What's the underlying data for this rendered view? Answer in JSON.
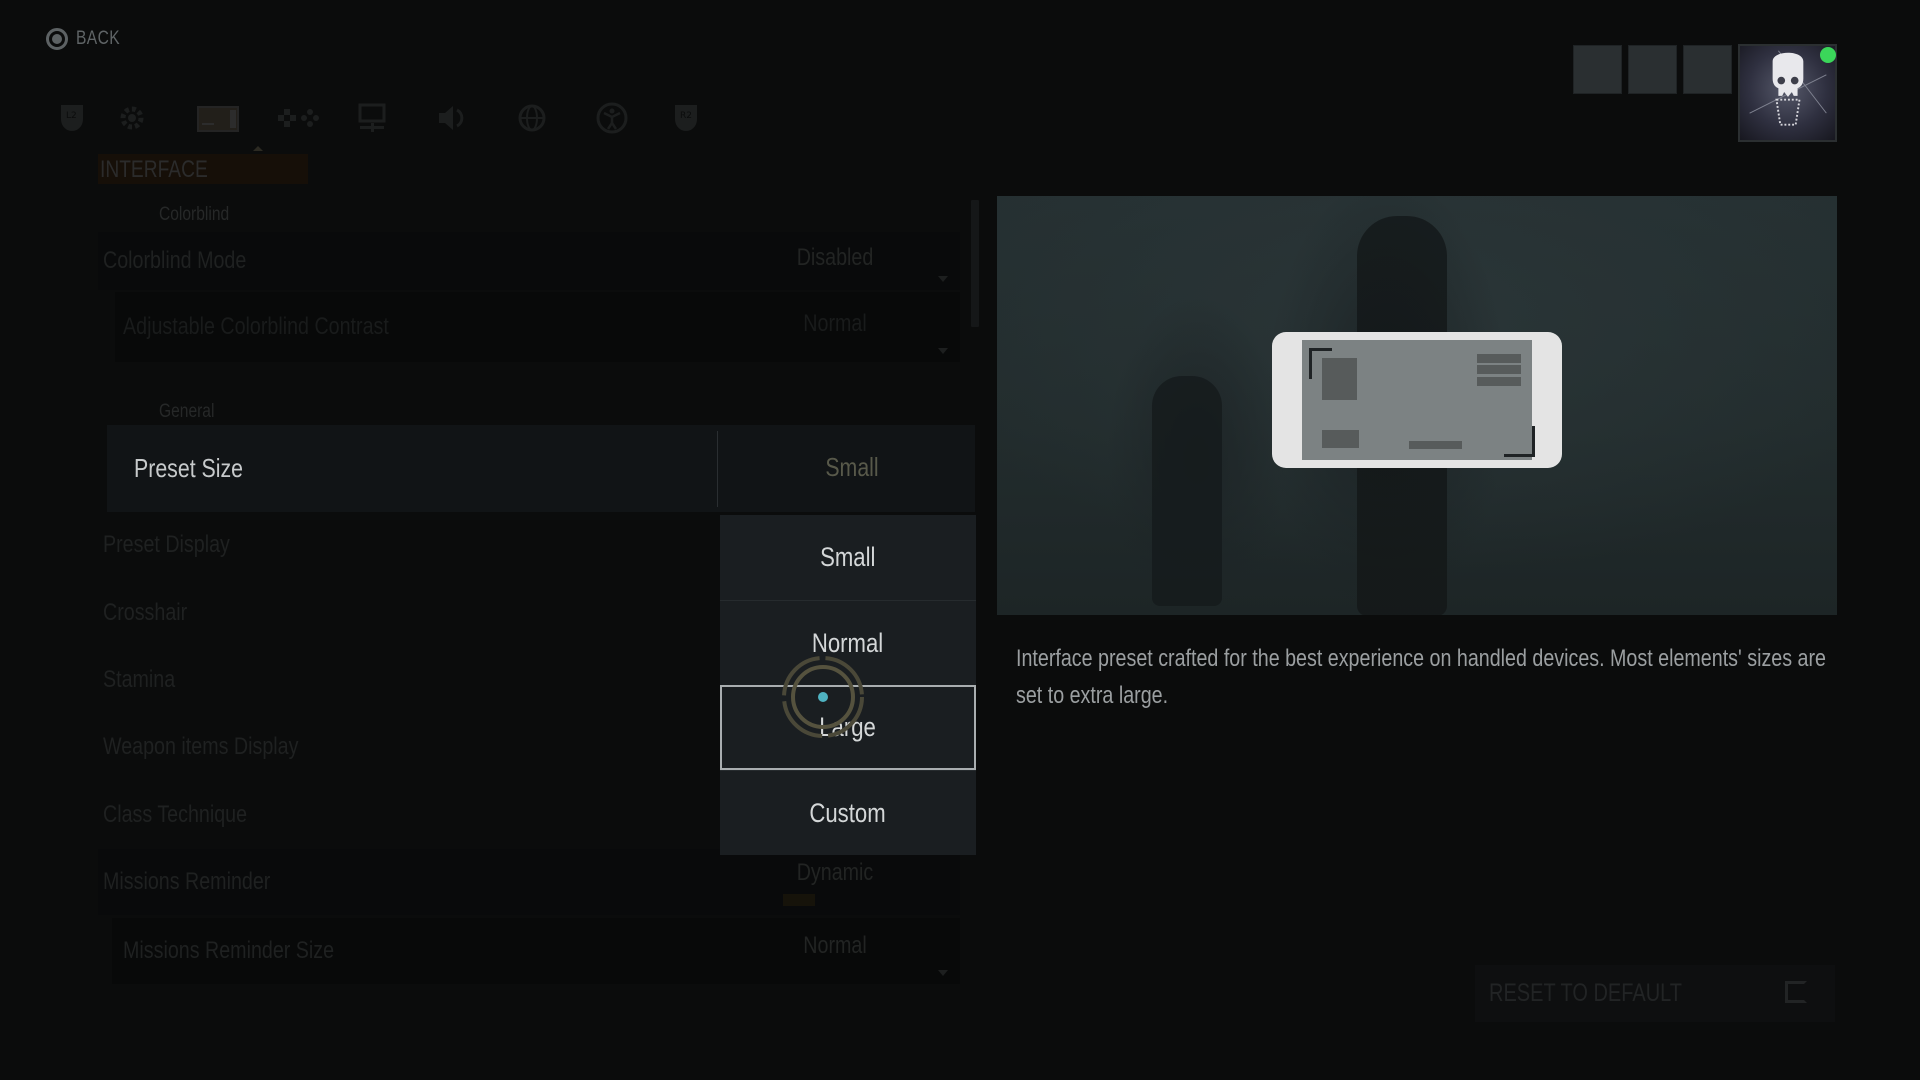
{
  "header": {
    "back_label": "BACK",
    "tabs": [
      {
        "icon": "l2-bumper-icon",
        "label": "L2"
      },
      {
        "icon": "gear-icon",
        "label": "General"
      },
      {
        "icon": "interface-icon",
        "label": "Interface",
        "active": true
      },
      {
        "icon": "controls-icon",
        "label": "Controls"
      },
      {
        "icon": "display-icon",
        "label": "Display"
      },
      {
        "icon": "audio-icon",
        "label": "Audio"
      },
      {
        "icon": "language-globe-icon",
        "label": "Language"
      },
      {
        "icon": "accessibility-icon",
        "label": "Accessibility"
      },
      {
        "icon": "r2-bumper-icon",
        "label": "R2"
      }
    ]
  },
  "section": {
    "title": "INTERFACE",
    "groups": {
      "colorblind": "Colorblind",
      "general": "General"
    }
  },
  "settings": {
    "colorblind_mode": {
      "label": "Colorblind Mode",
      "value": "Disabled"
    },
    "colorblind_contrast": {
      "label": "Adjustable Colorblind Contrast",
      "value": "Normal"
    },
    "preset_size": {
      "label": "Preset Size",
      "value": "Small"
    },
    "preset_display": {
      "label": "Preset Display"
    },
    "crosshair": {
      "label": "Crosshair"
    },
    "stamina": {
      "label": "Stamina"
    },
    "weapon_items_display": {
      "label": "Weapon items Display"
    },
    "class_technique": {
      "label": "Class Technique"
    },
    "missions_reminder": {
      "label": "Missions Reminder",
      "value": "Dynamic"
    },
    "missions_reminder_size": {
      "label": "Missions Reminder Size",
      "value": "Normal"
    }
  },
  "dropdown": {
    "options": [
      "Small",
      "Normal",
      "Large",
      "Custom"
    ],
    "focused": "Large"
  },
  "description": "Interface preset crafted for the best experience on handled devices. Most elements' sizes are set to extra large.",
  "footer": {
    "reset_label": "RESET TO DEFAULT"
  },
  "profile": {
    "status": "online",
    "status_color": "#3bd65a"
  },
  "colors": {
    "accent_focus": "#a9aeb0",
    "cursor_dot": "#4fb3c2"
  }
}
